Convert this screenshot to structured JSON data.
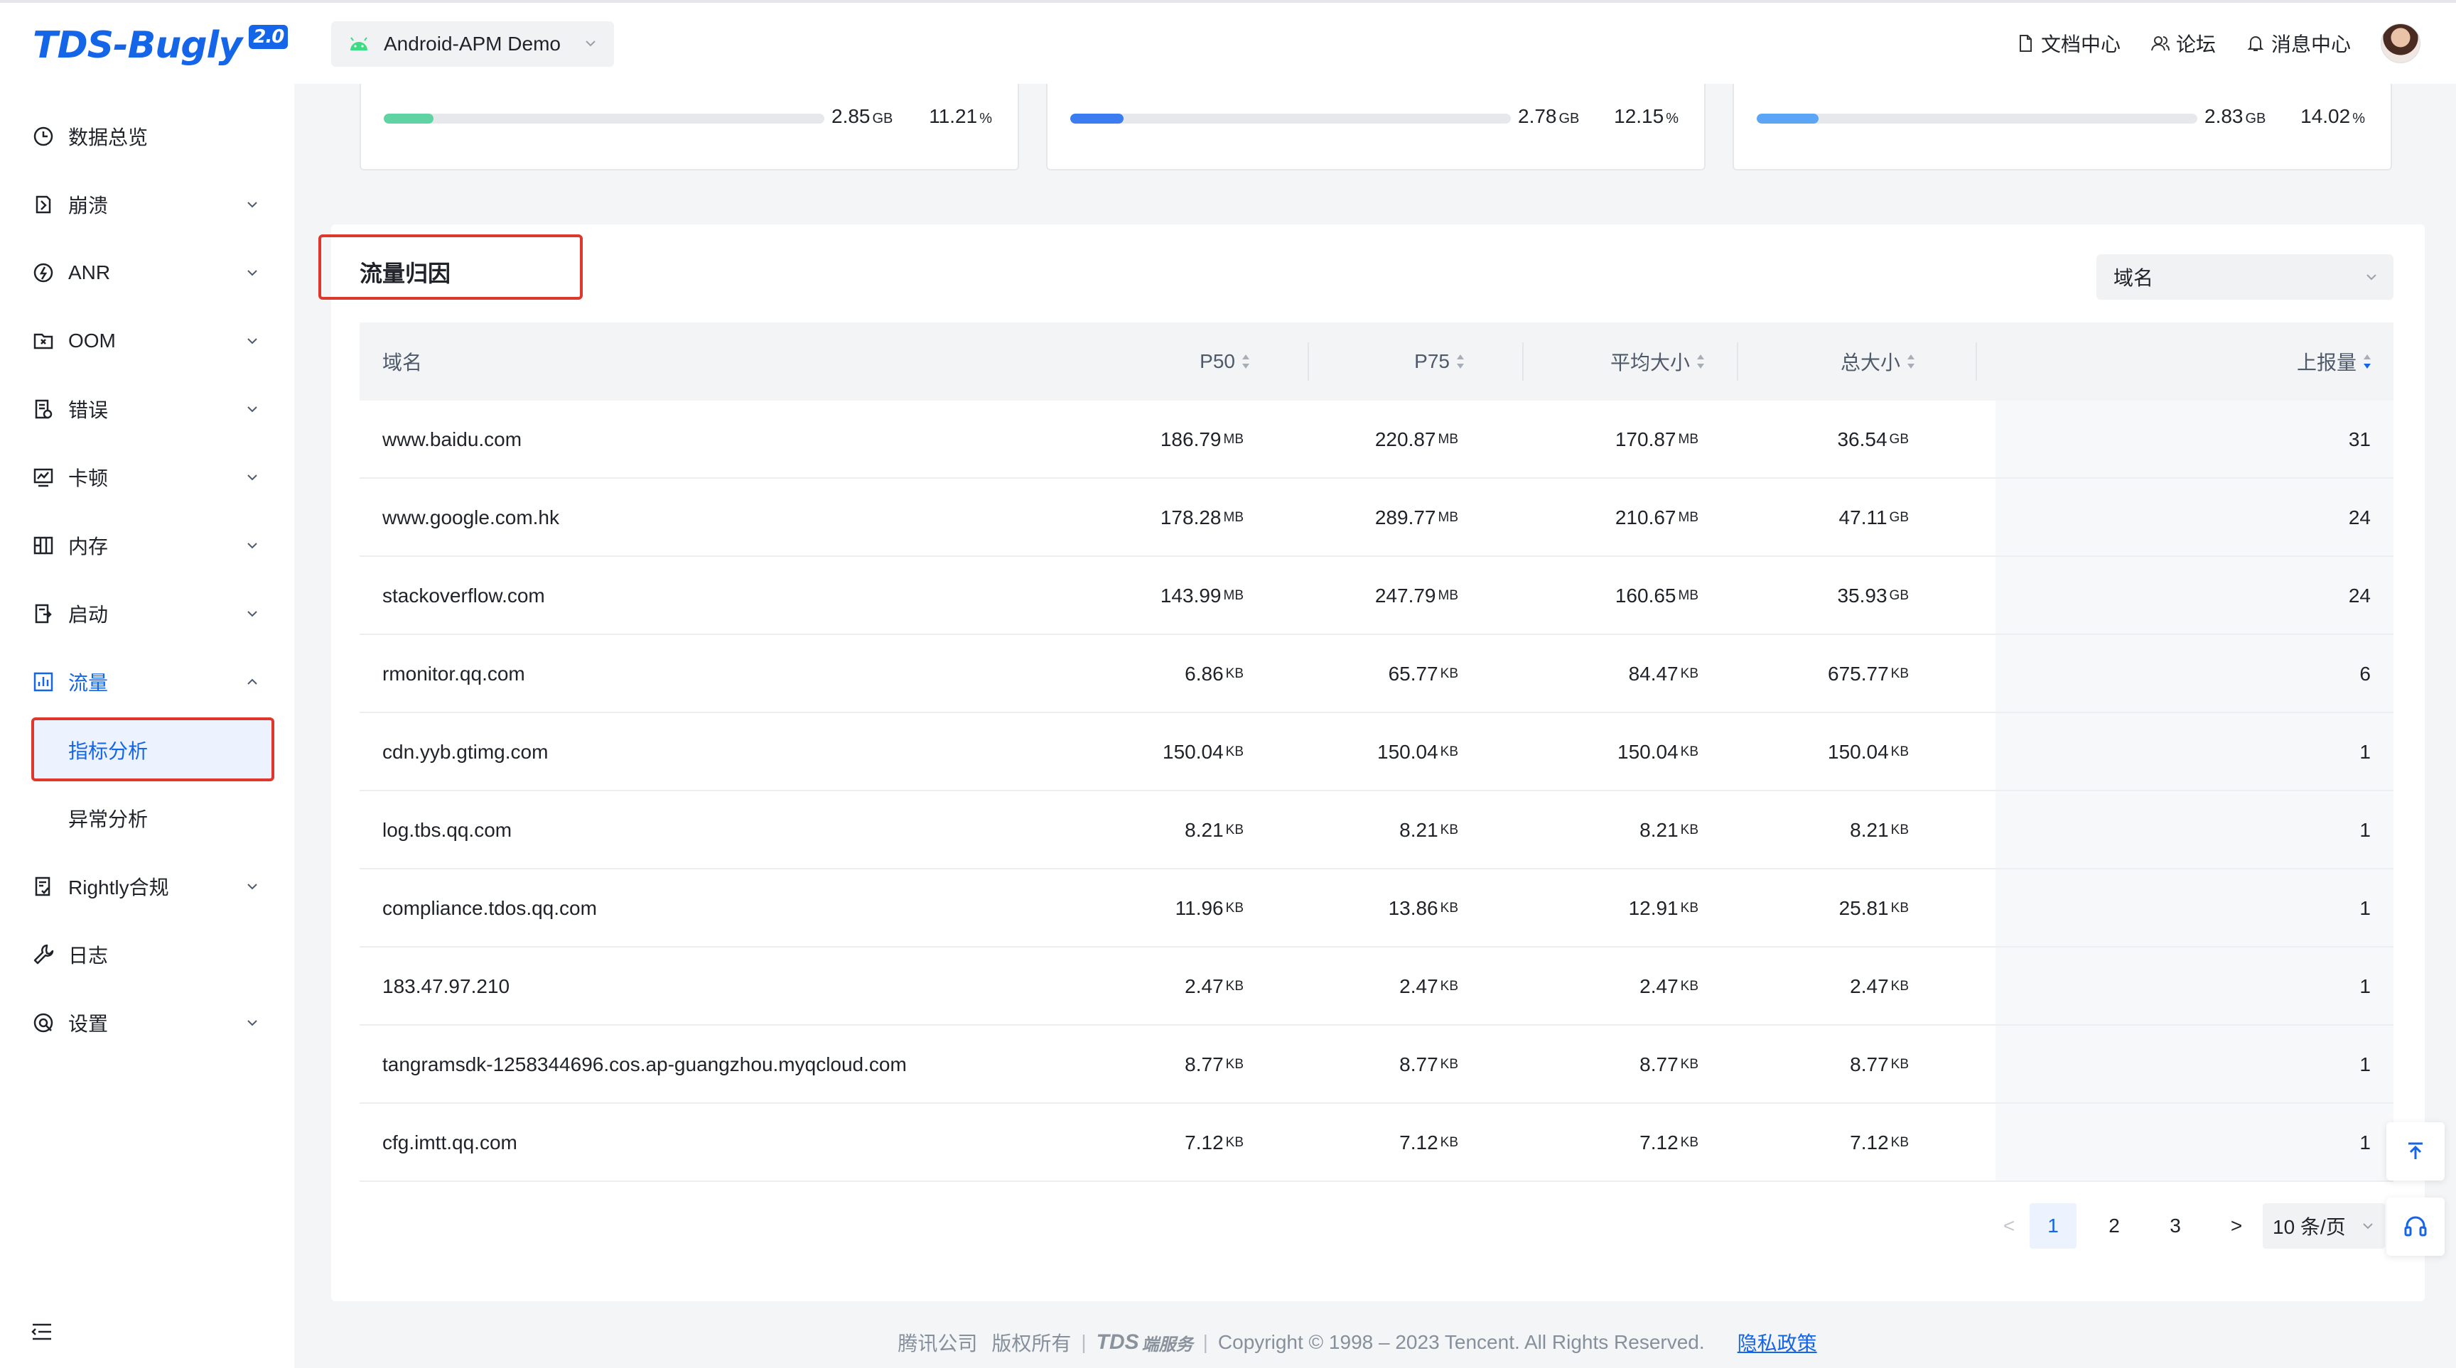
{
  "brand": {
    "logo_text": "TDS-Bugly",
    "logo_version": "2.0"
  },
  "header": {
    "app_name": "Android-APM Demo",
    "links": {
      "docs": "文档中心",
      "forum": "论坛",
      "messages": "消息中心"
    }
  },
  "sidebar": {
    "items": [
      {
        "label": "数据总览",
        "icon": "clock-icon"
      },
      {
        "label": "崩溃",
        "icon": "crash-icon"
      },
      {
        "label": "ANR",
        "icon": "anr-icon"
      },
      {
        "label": "OOM",
        "icon": "oom-icon"
      },
      {
        "label": "错误",
        "icon": "error-icon"
      },
      {
        "label": "卡顿",
        "icon": "lag-icon"
      },
      {
        "label": "内存",
        "icon": "memory-icon"
      },
      {
        "label": "启动",
        "icon": "launch-icon"
      },
      {
        "label": "流量",
        "icon": "traffic-icon"
      },
      {
        "label": "Rightly合规",
        "icon": "compliance-icon"
      },
      {
        "label": "日志",
        "icon": "wrench-icon"
      },
      {
        "label": "设置",
        "icon": "settings-icon"
      }
    ],
    "sub_items": [
      {
        "label": "指标分析"
      },
      {
        "label": "异常分析"
      }
    ]
  },
  "cards": [
    {
      "size": "2.85",
      "size_unit": "GB",
      "percent": "11.21",
      "percent_unit": "%",
      "fill_percent": 11.21,
      "color": "#5fd3a4"
    },
    {
      "size": "2.78",
      "size_unit": "GB",
      "percent": "12.15",
      "percent_unit": "%",
      "fill_percent": 12.15,
      "color": "#3b7cf0"
    },
    {
      "size": "2.83",
      "size_unit": "GB",
      "percent": "14.02",
      "percent_unit": "%",
      "fill_percent": 14.02,
      "color": "#5aa5f5"
    }
  ],
  "panel": {
    "title": "流量归因",
    "dimension_select": "域名",
    "columns": {
      "domain": "域名",
      "p50": "P50",
      "p75": "P75",
      "avg": "平均大小",
      "total": "总大小",
      "count": "上报量"
    },
    "rows": [
      {
        "domain": "www.baidu.com",
        "p50": "186.79",
        "p50_u": "MB",
        "p75": "220.87",
        "p75_u": "MB",
        "avg": "170.87",
        "avg_u": "MB",
        "total": "36.54",
        "total_u": "GB",
        "count": "31"
      },
      {
        "domain": "www.google.com.hk",
        "p50": "178.28",
        "p50_u": "MB",
        "p75": "289.77",
        "p75_u": "MB",
        "avg": "210.67",
        "avg_u": "MB",
        "total": "47.11",
        "total_u": "GB",
        "count": "24"
      },
      {
        "domain": "stackoverflow.com",
        "p50": "143.99",
        "p50_u": "MB",
        "p75": "247.79",
        "p75_u": "MB",
        "avg": "160.65",
        "avg_u": "MB",
        "total": "35.93",
        "total_u": "GB",
        "count": "24"
      },
      {
        "domain": "rmonitor.qq.com",
        "p50": "6.86",
        "p50_u": "KB",
        "p75": "65.77",
        "p75_u": "KB",
        "avg": "84.47",
        "avg_u": "KB",
        "total": "675.77",
        "total_u": "KB",
        "count": "6"
      },
      {
        "domain": "cdn.yyb.gtimg.com",
        "p50": "150.04",
        "p50_u": "KB",
        "p75": "150.04",
        "p75_u": "KB",
        "avg": "150.04",
        "avg_u": "KB",
        "total": "150.04",
        "total_u": "KB",
        "count": "1"
      },
      {
        "domain": "log.tbs.qq.com",
        "p50": "8.21",
        "p50_u": "KB",
        "p75": "8.21",
        "p75_u": "KB",
        "avg": "8.21",
        "avg_u": "KB",
        "total": "8.21",
        "total_u": "KB",
        "count": "1"
      },
      {
        "domain": "compliance.tdos.qq.com",
        "p50": "11.96",
        "p50_u": "KB",
        "p75": "13.86",
        "p75_u": "KB",
        "avg": "12.91",
        "avg_u": "KB",
        "total": "25.81",
        "total_u": "KB",
        "count": "1"
      },
      {
        "domain": "183.47.97.210",
        "p50": "2.47",
        "p50_u": "KB",
        "p75": "2.47",
        "p75_u": "KB",
        "avg": "2.47",
        "avg_u": "KB",
        "total": "2.47",
        "total_u": "KB",
        "count": "1"
      },
      {
        "domain": "tangramsdk-1258344696.cos.ap-guangzhou.myqcloud.com",
        "p50": "8.77",
        "p50_u": "KB",
        "p75": "8.77",
        "p75_u": "KB",
        "avg": "8.77",
        "avg_u": "KB",
        "total": "8.77",
        "total_u": "KB",
        "count": "1"
      },
      {
        "domain": "cfg.imtt.qq.com",
        "p50": "7.12",
        "p50_u": "KB",
        "p75": "7.12",
        "p75_u": "KB",
        "avg": "7.12",
        "avg_u": "KB",
        "total": "7.12",
        "total_u": "KB",
        "count": "1"
      }
    ],
    "pagination": {
      "prev": "<",
      "pages": [
        "1",
        "2",
        "3"
      ],
      "current": "1",
      "next": ">",
      "page_size": "10 条/页"
    }
  },
  "footer": {
    "company": "腾讯公司",
    "rights": "版权所有",
    "logo_text": "TDS",
    "logo_sub": "端服务",
    "copyright": "Copyright © 1998 – 2023 Tencent. All Rights Reserved.",
    "privacy": "隐私政策"
  },
  "colors": {
    "accent": "#1565e8",
    "highlight_box": "#e0372c"
  }
}
